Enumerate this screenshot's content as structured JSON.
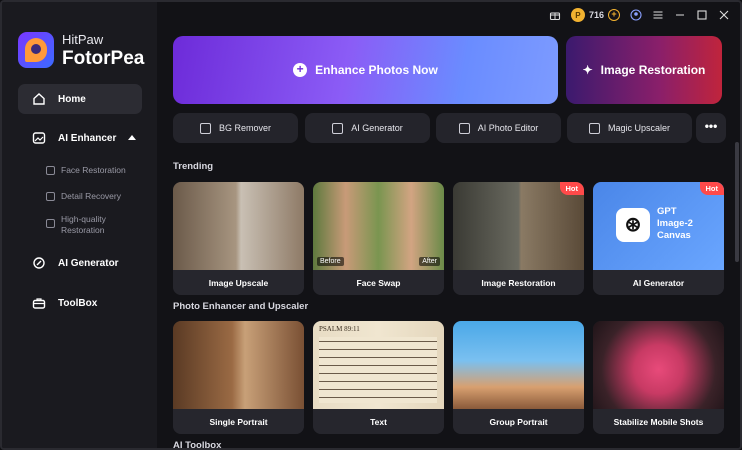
{
  "brand": {
    "line1": "HitPaw",
    "line2": "FotorPea"
  },
  "sidebar": {
    "items": [
      {
        "label": "Home",
        "icon": "home-icon"
      },
      {
        "label": "AI Enhancer",
        "icon": "enhancer-icon"
      },
      {
        "label": "AI Generator",
        "icon": "generator-icon"
      },
      {
        "label": "ToolBox",
        "icon": "toolbox-icon"
      }
    ],
    "sub_items": [
      {
        "label": "Face Restoration"
      },
      {
        "label": "Detail Recovery"
      },
      {
        "label": "High-quality",
        "label2": "Restoration"
      }
    ]
  },
  "topbar": {
    "credits": "716"
  },
  "hero": {
    "enhance_label": "Enhance Photos Now",
    "restore_label": "Image Restoration"
  },
  "tools": [
    {
      "label": "BG Remover"
    },
    {
      "label": "AI Generator"
    },
    {
      "label": "AI Photo Editor"
    },
    {
      "label": "Magic Upscaler"
    }
  ],
  "more_label": "•••",
  "sections": {
    "trending": "Trending",
    "photo_enhancer": "Photo Enhancer and Upscaler",
    "ai_toolbox": "AI Toolbox"
  },
  "trending_cards": [
    {
      "label": "Image Upscale"
    },
    {
      "label": "Face Swap",
      "before": "Before",
      "after": "After"
    },
    {
      "label": "Image Restoration",
      "badge": "Hot"
    },
    {
      "label": "AI Generator",
      "badge": "Hot",
      "overlay_line1": "GPT",
      "overlay_line2": "Image-2",
      "overlay_line3": "Canvas"
    }
  ],
  "enhancer_cards": [
    {
      "label": "Single Portrait"
    },
    {
      "label": "Text",
      "doc_title": "PSALM 89:11"
    },
    {
      "label": "Group Portrait"
    },
    {
      "label": "Stabilize Mobile Shots"
    }
  ],
  "colors": {
    "accent": "#8b5cf6",
    "hot": "#ff4a4a",
    "coin": "#f2b230"
  }
}
